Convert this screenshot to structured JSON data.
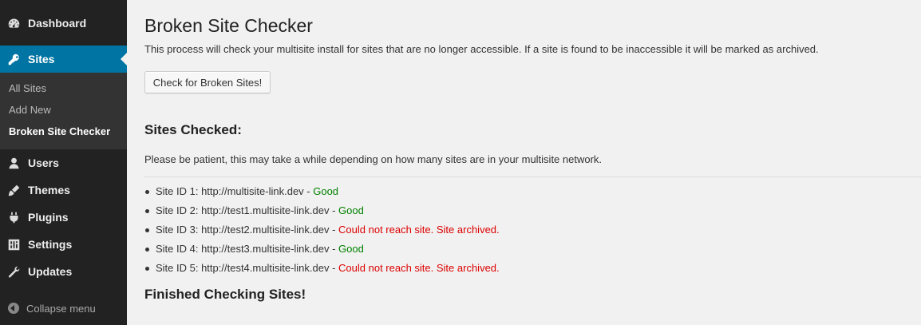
{
  "sidebar": {
    "items": [
      {
        "label": "Dashboard",
        "icon": "dashboard-icon"
      },
      {
        "label": "Sites",
        "icon": "sites-key-icon"
      },
      {
        "label": "Users",
        "icon": "users-icon"
      },
      {
        "label": "Themes",
        "icon": "themes-brush-icon"
      },
      {
        "label": "Plugins",
        "icon": "plugins-icon"
      },
      {
        "label": "Settings",
        "icon": "settings-icon"
      },
      {
        "label": "Updates",
        "icon": "updates-wrench-icon"
      }
    ],
    "submenu": [
      "All Sites",
      "Add New",
      "Broken Site Checker"
    ],
    "collapse_label": "Collapse menu",
    "colors": {
      "background": "#222222",
      "current": "#0074a2",
      "submenu": "#333333"
    }
  },
  "page": {
    "title": "Broken Site Checker",
    "intro": "This process will check your multisite install for sites that are no longer accessible. If a site is found to be inaccessible it will be marked as archived.",
    "button_label": "Check for Broken Sites!",
    "sites_checked_heading": "Sites Checked:",
    "patience_text": "Please be patient, this may take a while depending on how many sites are in your multisite network.",
    "results": [
      {
        "prefix": "Site ID 1: http://multisite-link.dev - ",
        "status": "Good",
        "ok": true
      },
      {
        "prefix": "Site ID 2: http://test1.multisite-link.dev - ",
        "status": "Good",
        "ok": true
      },
      {
        "prefix": "Site ID 3: http://test2.multisite-link.dev - ",
        "status": "Could not reach site. Site archived.",
        "ok": false
      },
      {
        "prefix": "Site ID 4: http://test3.multisite-link.dev - ",
        "status": "Good",
        "ok": true
      },
      {
        "prefix": "Site ID 5: http://test4.multisite-link.dev - ",
        "status": "Could not reach site. Site archived.",
        "ok": false
      }
    ],
    "finished_heading": "Finished Checking Sites!",
    "colors": {
      "good": "#008000",
      "bad": "#dd0000"
    }
  }
}
